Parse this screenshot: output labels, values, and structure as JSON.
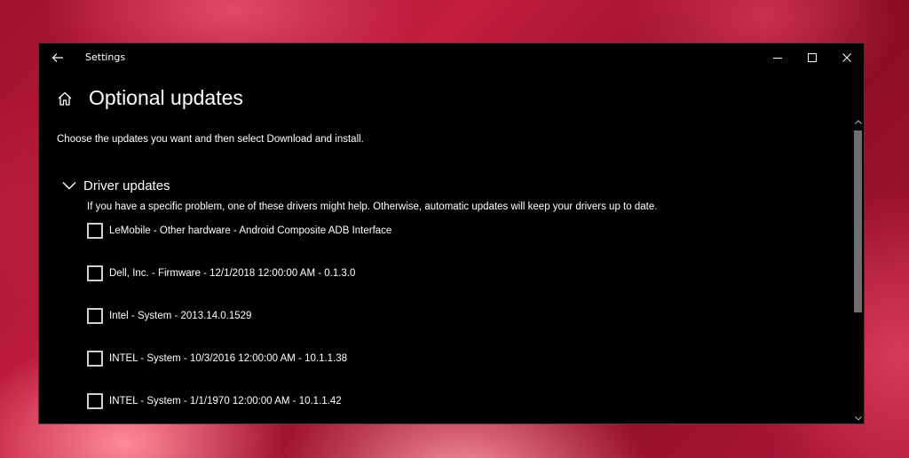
{
  "window": {
    "title": "Settings",
    "buttons": {
      "minimize": "minimize-icon",
      "maximize": "maximize-icon",
      "close": "close-icon"
    }
  },
  "page": {
    "title": "Optional updates",
    "intro": "Choose the updates you want and then select Download and install."
  },
  "section": {
    "title": "Driver updates",
    "expanded": true,
    "description": "If you have a specific problem, one of these drivers might help. Otherwise, automatic updates will keep your drivers up to date."
  },
  "drivers": [
    {
      "label": "LeMobile - Other hardware - Android Composite ADB Interface",
      "checked": false
    },
    {
      "label": "Dell, Inc. - Firmware - 12/1/2018 12:00:00 AM - 0.1.3.0",
      "checked": false
    },
    {
      "label": "Intel - System - 2013.14.0.1529",
      "checked": false
    },
    {
      "label": "INTEL - System - 10/3/2016 12:00:00 AM - 10.1.1.38",
      "checked": false
    },
    {
      "label": "INTEL - System - 1/1/1970 12:00:00 AM - 10.1.1.42",
      "checked": false
    }
  ],
  "theme": {
    "background": "#000000",
    "text": "#ffffff",
    "scroll_thumb": "#6e6e6e"
  }
}
